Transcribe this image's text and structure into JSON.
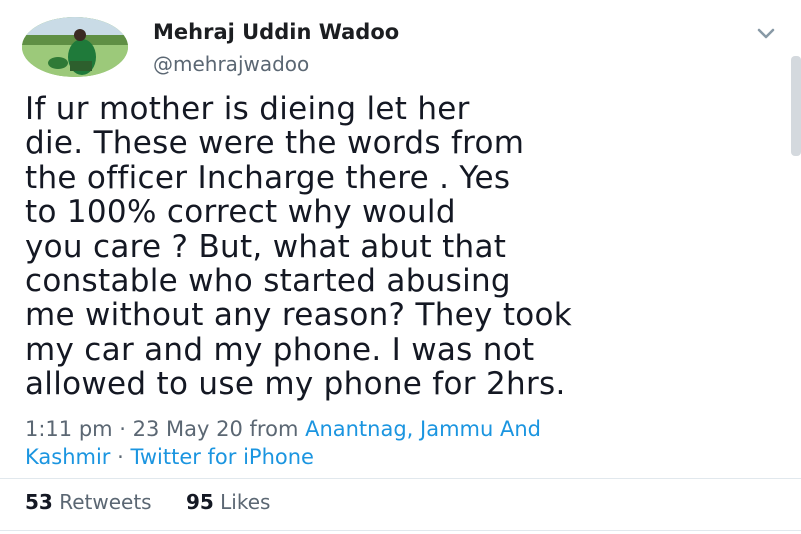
{
  "author": {
    "name": "Mehraj Uddin Wadoo",
    "handle": "@mehrajwadoo",
    "avatar_icon": "profile-photo-avatar"
  },
  "tweet": {
    "lines": [
      "If ur mother is dieing let her",
      "die. These were the words from",
      "the officer Incharge there . Yes",
      "to 100% correct why would",
      "you care ? But, what abut that",
      "constable who started abusing",
      "me without any reason? They took",
      "my car and my phone. I was not",
      "allowed to use my phone for 2hrs."
    ]
  },
  "meta": {
    "time_date": "1:11 pm · 23 May 20 from ",
    "location_part1": "Anantnag, Jammu And",
    "location_part2": "Kashmir",
    "separator": " · ",
    "source": "Twitter for iPhone"
  },
  "stats": {
    "retweets_count": "53",
    "retweets_label": "Retweets",
    "likes_count": "95",
    "likes_label": "Likes"
  },
  "colors": {
    "link": "#1b95e0",
    "muted": "#5b6773",
    "text": "#141823"
  },
  "icons": {
    "menu": "chevron-down-icon"
  }
}
